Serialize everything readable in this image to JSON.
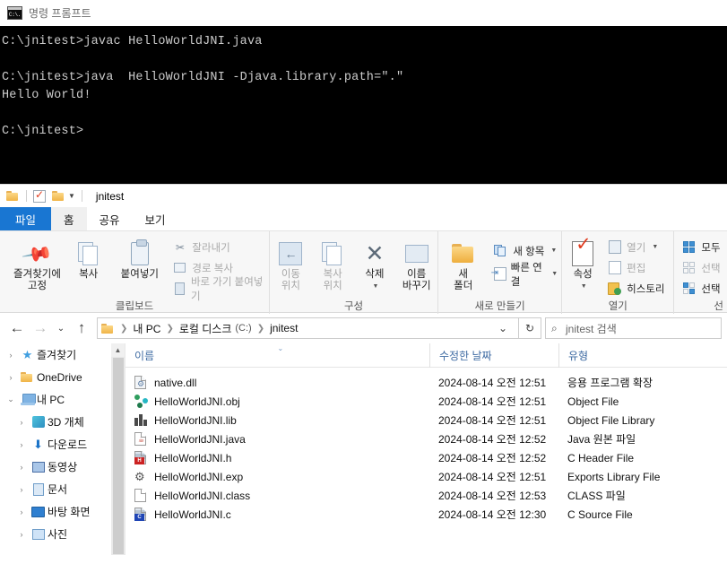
{
  "cmd": {
    "title": "명령 프롬프트",
    "icon": "cmd-icon",
    "lines": [
      "C:\\jnitest>javac HelloWorldJNI.java",
      "",
      "C:\\jnitest>java  HelloWorldJNI -Djava.library.path=\".\"",
      "Hello World!",
      "",
      "C:\\jnitest>"
    ]
  },
  "explorer": {
    "quick_access": {
      "title": "jnitest",
      "buttons": [
        "folder-icon",
        "properties-icon",
        "new-folder-icon",
        "customize-chevron-icon"
      ]
    },
    "tabs": [
      {
        "label": "파일",
        "type": "file"
      },
      {
        "label": "홈",
        "type": "active"
      },
      {
        "label": "공유",
        "type": "normal"
      },
      {
        "label": "보기",
        "type": "normal"
      }
    ],
    "ribbon": {
      "groups": [
        {
          "label": "클립보드",
          "big": [
            {
              "label": "즐겨찾기에\n고정",
              "icon": "pin-icon"
            },
            {
              "label": "복사",
              "icon": "copy-icon"
            },
            {
              "label": "붙여넣기",
              "icon": "paste-icon"
            }
          ],
          "small": [
            {
              "label": "잘라내기",
              "icon": "scissors-icon",
              "dim": true
            },
            {
              "label": "경로 복사",
              "icon": "copy-path-icon",
              "dim": true
            },
            {
              "label": "바로 가기 붙여넣기",
              "icon": "paste-shortcut-icon",
              "dim": true
            }
          ]
        },
        {
          "label": "구성",
          "big": [
            {
              "label": "이동\n위치",
              "icon": "move-to-icon",
              "caret": true,
              "dim": true
            },
            {
              "label": "복사\n위치",
              "icon": "copy-to-icon",
              "caret": true,
              "dim": true
            },
            {
              "label": "삭제",
              "icon": "delete-icon",
              "caret": true
            },
            {
              "label": "이름\n바꾸기",
              "icon": "rename-icon"
            }
          ],
          "small": []
        },
        {
          "label": "새로 만들기",
          "big": [
            {
              "label": "새\n폴더",
              "icon": "new-folder-icon"
            }
          ],
          "small": [
            {
              "label": "새 항목",
              "icon": "new-item-icon",
              "caret": true
            },
            {
              "label": "빠른 연결",
              "icon": "quick-access-icon",
              "caret": true
            }
          ]
        },
        {
          "label": "열기",
          "big": [
            {
              "label": "속성",
              "icon": "properties-icon",
              "caret": true
            }
          ],
          "small": [
            {
              "label": "열기",
              "icon": "open-icon",
              "caret": true,
              "dim": true
            },
            {
              "label": "편집",
              "icon": "edit-icon",
              "dim": true
            },
            {
              "label": "히스토리",
              "icon": "history-icon"
            }
          ]
        },
        {
          "label": "선",
          "big": [],
          "small": [
            {
              "label": "모두",
              "icon": "select-all-icon"
            },
            {
              "label": "선택",
              "icon": "select-none-icon",
              "dim": true
            },
            {
              "label": "선택",
              "icon": "invert-selection-icon"
            }
          ]
        }
      ]
    },
    "address": {
      "back": "←",
      "forward": "→",
      "recent": "⌄",
      "up": "↑",
      "breadcrumb": [
        {
          "label": "내 PC",
          "dim": false
        },
        {
          "label": "로컬 디스크",
          "suffix": "(C:)",
          "dim": false
        },
        {
          "label": "jnitest",
          "dim": false
        }
      ],
      "dropdown": "⌄",
      "refresh": "↻",
      "search_placeholder": "jnitest 검색"
    },
    "navpane": {
      "items": [
        {
          "label": "즐겨찾기",
          "icon": "favorites-star-icon",
          "arrow": "›",
          "indent": 0
        },
        {
          "label": "OneDrive",
          "icon": "onedrive-folder-icon",
          "arrow": "›",
          "indent": 0
        },
        {
          "label": "내 PC",
          "icon": "this-pc-icon",
          "arrow": "⌄",
          "indent": 0
        },
        {
          "label": "3D 개체",
          "icon": "3d-objects-icon",
          "arrow": "›",
          "indent": 1
        },
        {
          "label": "다운로드",
          "icon": "downloads-icon",
          "arrow": "›",
          "indent": 1
        },
        {
          "label": "동영상",
          "icon": "videos-icon",
          "arrow": "›",
          "indent": 1
        },
        {
          "label": "문서",
          "icon": "documents-icon",
          "arrow": "›",
          "indent": 1
        },
        {
          "label": "바탕 화면",
          "icon": "desktop-icon",
          "arrow": "›",
          "indent": 1
        },
        {
          "label": "사진",
          "icon": "pictures-icon",
          "arrow": "›",
          "indent": 1
        }
      ]
    },
    "filelist": {
      "columns": [
        {
          "label": "이름",
          "sorted": true
        },
        {
          "label": "수정한 날짜",
          "sorted": false
        },
        {
          "label": "유형",
          "sorted": false
        }
      ],
      "rows": [
        {
          "name": "native.dll",
          "icon": "dll-file-icon",
          "date": "2024-08-14 오전 12:51",
          "type": "응용 프로그램 확장"
        },
        {
          "name": "HelloWorldJNI.obj",
          "icon": "obj-file-icon",
          "date": "2024-08-14 오전 12:51",
          "type": "Object File"
        },
        {
          "name": "HelloWorldJNI.lib",
          "icon": "lib-file-icon",
          "date": "2024-08-14 오전 12:51",
          "type": "Object File Library"
        },
        {
          "name": "HelloWorldJNI.java",
          "icon": "java-file-icon",
          "date": "2024-08-14 오전 12:52",
          "type": "Java 원본 파일"
        },
        {
          "name": "HelloWorldJNI.h",
          "icon": "header-file-icon",
          "date": "2024-08-14 오전 12:52",
          "type": "C Header File"
        },
        {
          "name": "HelloWorldJNI.exp",
          "icon": "exp-file-icon",
          "date": "2024-08-14 오전 12:51",
          "type": "Exports Library File"
        },
        {
          "name": "HelloWorldJNI.class",
          "icon": "class-file-icon",
          "date": "2024-08-14 오전 12:53",
          "type": "CLASS 파일"
        },
        {
          "name": "HelloWorldJNI.c",
          "icon": "c-source-file-icon",
          "date": "2024-08-14 오전 12:30",
          "type": "C Source File"
        }
      ]
    }
  }
}
